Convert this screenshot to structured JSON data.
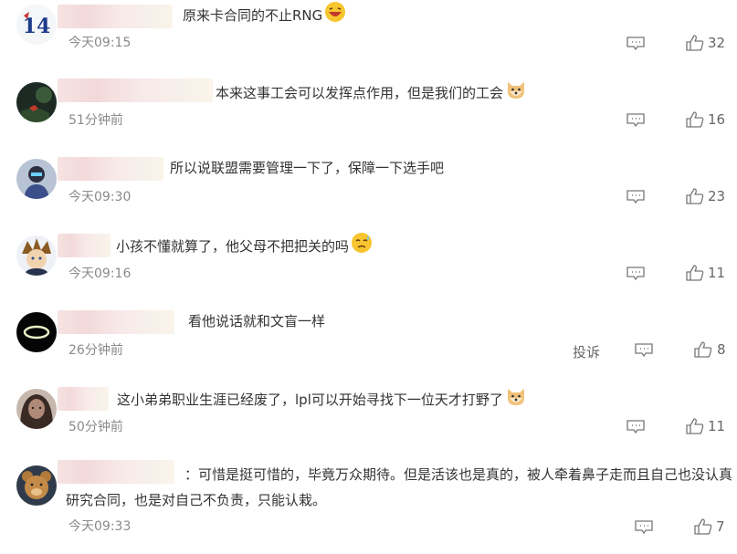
{
  "comments": [
    {
      "text": "原来卡合同的不止RNG",
      "time": "今天09:15",
      "likes": "32",
      "emoji": "laugh-emoji"
    },
    {
      "text": "本来这事工会可以发挥点作用，但是我们的工会",
      "time": "51分钟前",
      "likes": "16",
      "emoji": "doge-emoji"
    },
    {
      "text": "所以说联盟需要管理一下了，保障一下选手吧",
      "time": "今天09:30",
      "likes": "23"
    },
    {
      "text": "小孩不懂就算了，他父母不把把关的吗",
      "time": "今天09:16",
      "likes": "11",
      "emoji": "sweat-emoji"
    },
    {
      "text": "看他说话就和文盲一样",
      "time": "26分钟前",
      "likes": "8",
      "report": "投诉"
    },
    {
      "text": "这小弟弟职业生涯已经废了，lpl可以开始寻找下一位天才打野了",
      "time": "50分钟前",
      "likes": "11",
      "emoji": "doge-emoji"
    },
    {
      "text": "：可惜是挺可惜的，毕竟万众期待。但是活该也是真的，被人牵着鼻子走而且自己也没认真研究合同，也是对自己不负责，只能认栽。",
      "time": "今天09:33",
      "likes": "7"
    }
  ],
  "icons": {
    "reply": "comment-icon",
    "like": "thumbs-up-icon"
  },
  "colors": {
    "text": "#333333",
    "meta": "#8a8a8a",
    "icon": "#777777"
  }
}
